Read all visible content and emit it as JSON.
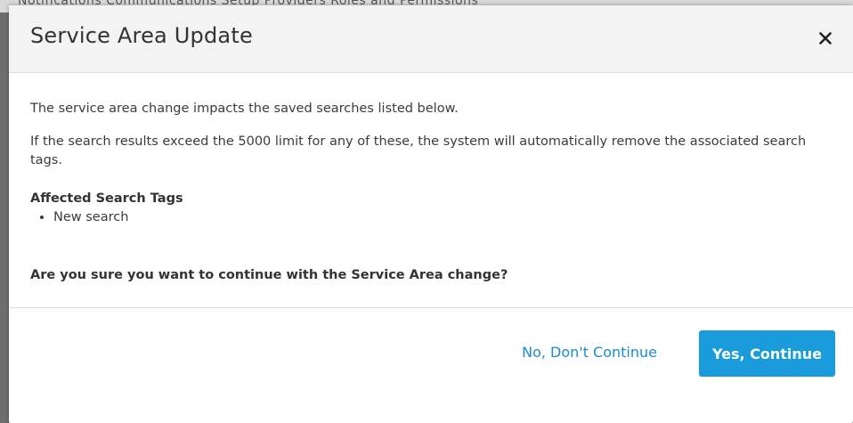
{
  "background": {
    "nav_text": "Notifications    Communications    Setup    Providers    Roles and Permissions"
  },
  "dialog": {
    "title": "Service Area Update",
    "close_icon": "close-icon",
    "intro": "The service area change impacts the saved searches listed below.",
    "limit_notice": "If the search results exceed the 5000 limit for any of these, the system will automatically remove the associated search tags.",
    "tags_heading": "Affected Search Tags",
    "tags": [
      "New search"
    ],
    "question": "Are you sure you want to continue with the Service Area change?",
    "cancel_label": "No, Don't Continue",
    "confirm_label": "Yes, Continue"
  },
  "colors": {
    "primary": "#1a9bdc",
    "link": "#1a8cd0",
    "header_bg": "#f3f3f3"
  }
}
